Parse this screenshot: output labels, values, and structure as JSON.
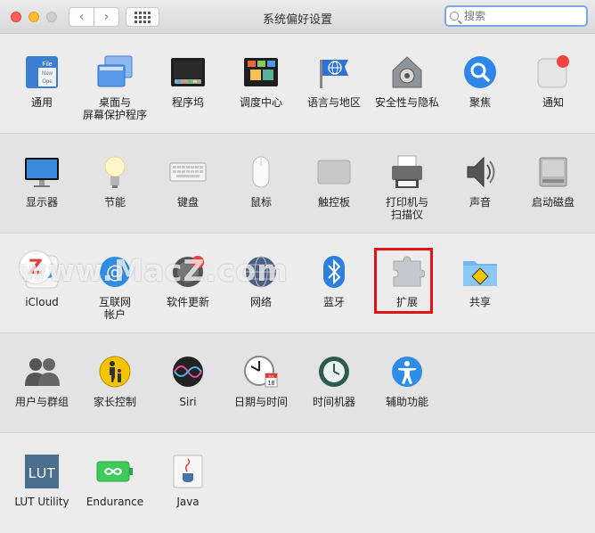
{
  "window": {
    "title": "系统偏好设置",
    "search_placeholder": "搜索"
  },
  "rows": [
    [
      {
        "label": "通用",
        "icon": "general-icon"
      },
      {
        "label": "桌面与\n屏幕保护程序",
        "icon": "desktop-screensaver-icon"
      },
      {
        "label": "程序坞",
        "icon": "dock-icon"
      },
      {
        "label": "调度中心",
        "icon": "mission-control-icon"
      },
      {
        "label": "语言与地区",
        "icon": "language-region-icon"
      },
      {
        "label": "安全性与隐私",
        "icon": "security-privacy-icon"
      },
      {
        "label": "聚焦",
        "icon": "spotlight-icon"
      },
      {
        "label": "通知",
        "icon": "notifications-icon"
      }
    ],
    [
      {
        "label": "显示器",
        "icon": "displays-icon"
      },
      {
        "label": "节能",
        "icon": "energy-saver-icon"
      },
      {
        "label": "键盘",
        "icon": "keyboard-icon"
      },
      {
        "label": "鼠标",
        "icon": "mouse-icon"
      },
      {
        "label": "触控板",
        "icon": "trackpad-icon"
      },
      {
        "label": "打印机与\n扫描仪",
        "icon": "printer-scanner-icon"
      },
      {
        "label": "声音",
        "icon": "sound-icon"
      },
      {
        "label": "启动磁盘",
        "icon": "startup-disk-icon"
      }
    ],
    [
      {
        "label": "iCloud",
        "icon": "icloud-icon"
      },
      {
        "label": "互联网\n帐户",
        "icon": "internet-accounts-icon"
      },
      {
        "label": "软件更新",
        "icon": "software-update-icon"
      },
      {
        "label": "网络",
        "icon": "network-icon"
      },
      {
        "label": "蓝牙",
        "icon": "bluetooth-icon"
      },
      {
        "label": "扩展",
        "icon": "extensions-icon"
      },
      {
        "label": "共享",
        "icon": "sharing-icon"
      }
    ],
    [
      {
        "label": "用户与群组",
        "icon": "users-groups-icon"
      },
      {
        "label": "家长控制",
        "icon": "parental-controls-icon"
      },
      {
        "label": "Siri",
        "icon": "siri-icon"
      },
      {
        "label": "日期与时间",
        "icon": "date-time-icon"
      },
      {
        "label": "时间机器",
        "icon": "time-machine-icon"
      },
      {
        "label": "辅助功能",
        "icon": "accessibility-icon"
      }
    ],
    [
      {
        "label": "LUT Utility",
        "icon": "lut-utility-icon"
      },
      {
        "label": "Endurance",
        "icon": "endurance-icon"
      },
      {
        "label": "Java",
        "icon": "java-icon"
      }
    ]
  ],
  "icon_text": {
    "general_file": "File",
    "general_new": "New",
    "general_open": "Ope",
    "calendar_month": "JUL",
    "calendar_day": "18",
    "lut": "LUT"
  },
  "watermark": {
    "text": "www.MacZ.com",
    "badge": "Z"
  },
  "colors": {
    "highlight_border": "#e11414",
    "search_focus": "#7aa7e8"
  }
}
